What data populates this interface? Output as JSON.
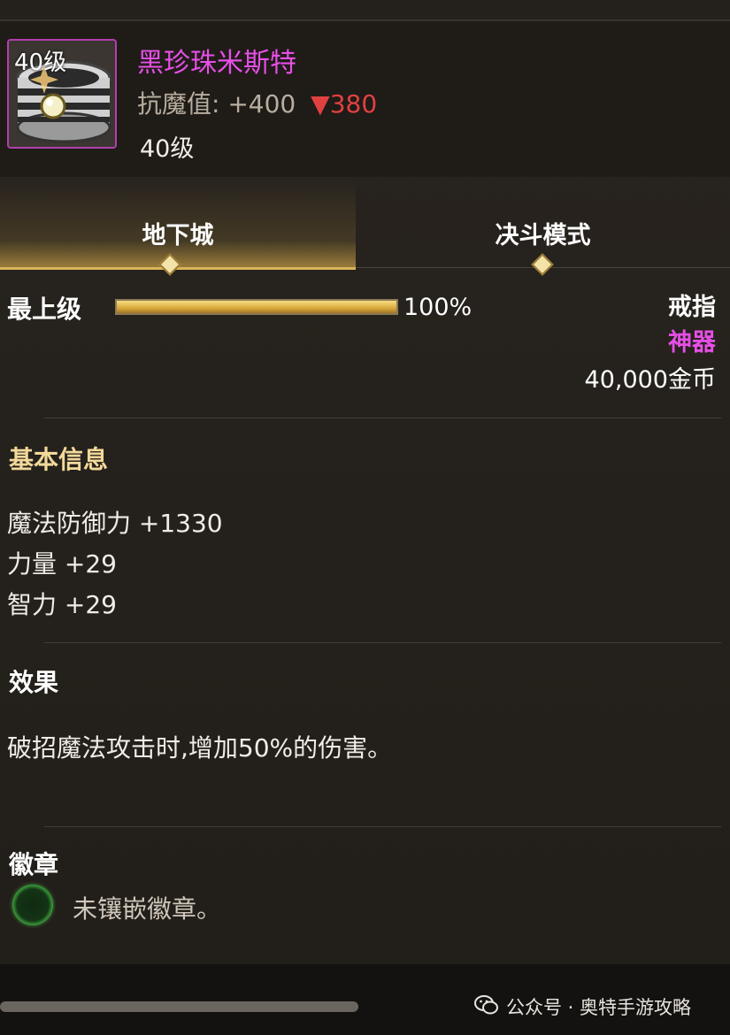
{
  "item": {
    "icon_level": "40级",
    "name": "黑珍珠米斯特",
    "stat_label": "抗魔值:",
    "stat_value": "+400",
    "stat_change": "▼380",
    "level": "40级"
  },
  "tabs": [
    {
      "label": "地下城",
      "active": true
    },
    {
      "label": "决斗模式",
      "active": false
    }
  ],
  "grade": {
    "label": "最上级",
    "progress_fraction": 1.0,
    "percent_text": "100%"
  },
  "item_type": "戒指",
  "rarity": "神器",
  "price": "40,000金币",
  "basic_info": {
    "title": "基本信息",
    "lines": [
      "魔法防御力 +1330",
      "力量 +29",
      "智力 +29"
    ]
  },
  "effect": {
    "title": "效果",
    "text": "破招魔法攻击时,增加50%的伤害。"
  },
  "emblem": {
    "title": "徽章",
    "text": "未镶嵌徽章。"
  },
  "watermark": "公众号 · 奥特手游攻略",
  "colors": {
    "legendary_name": "#e64fe6",
    "decrease": "#e14040",
    "section_title": "#f2d89a",
    "tab_accent": "#d9b45a"
  }
}
